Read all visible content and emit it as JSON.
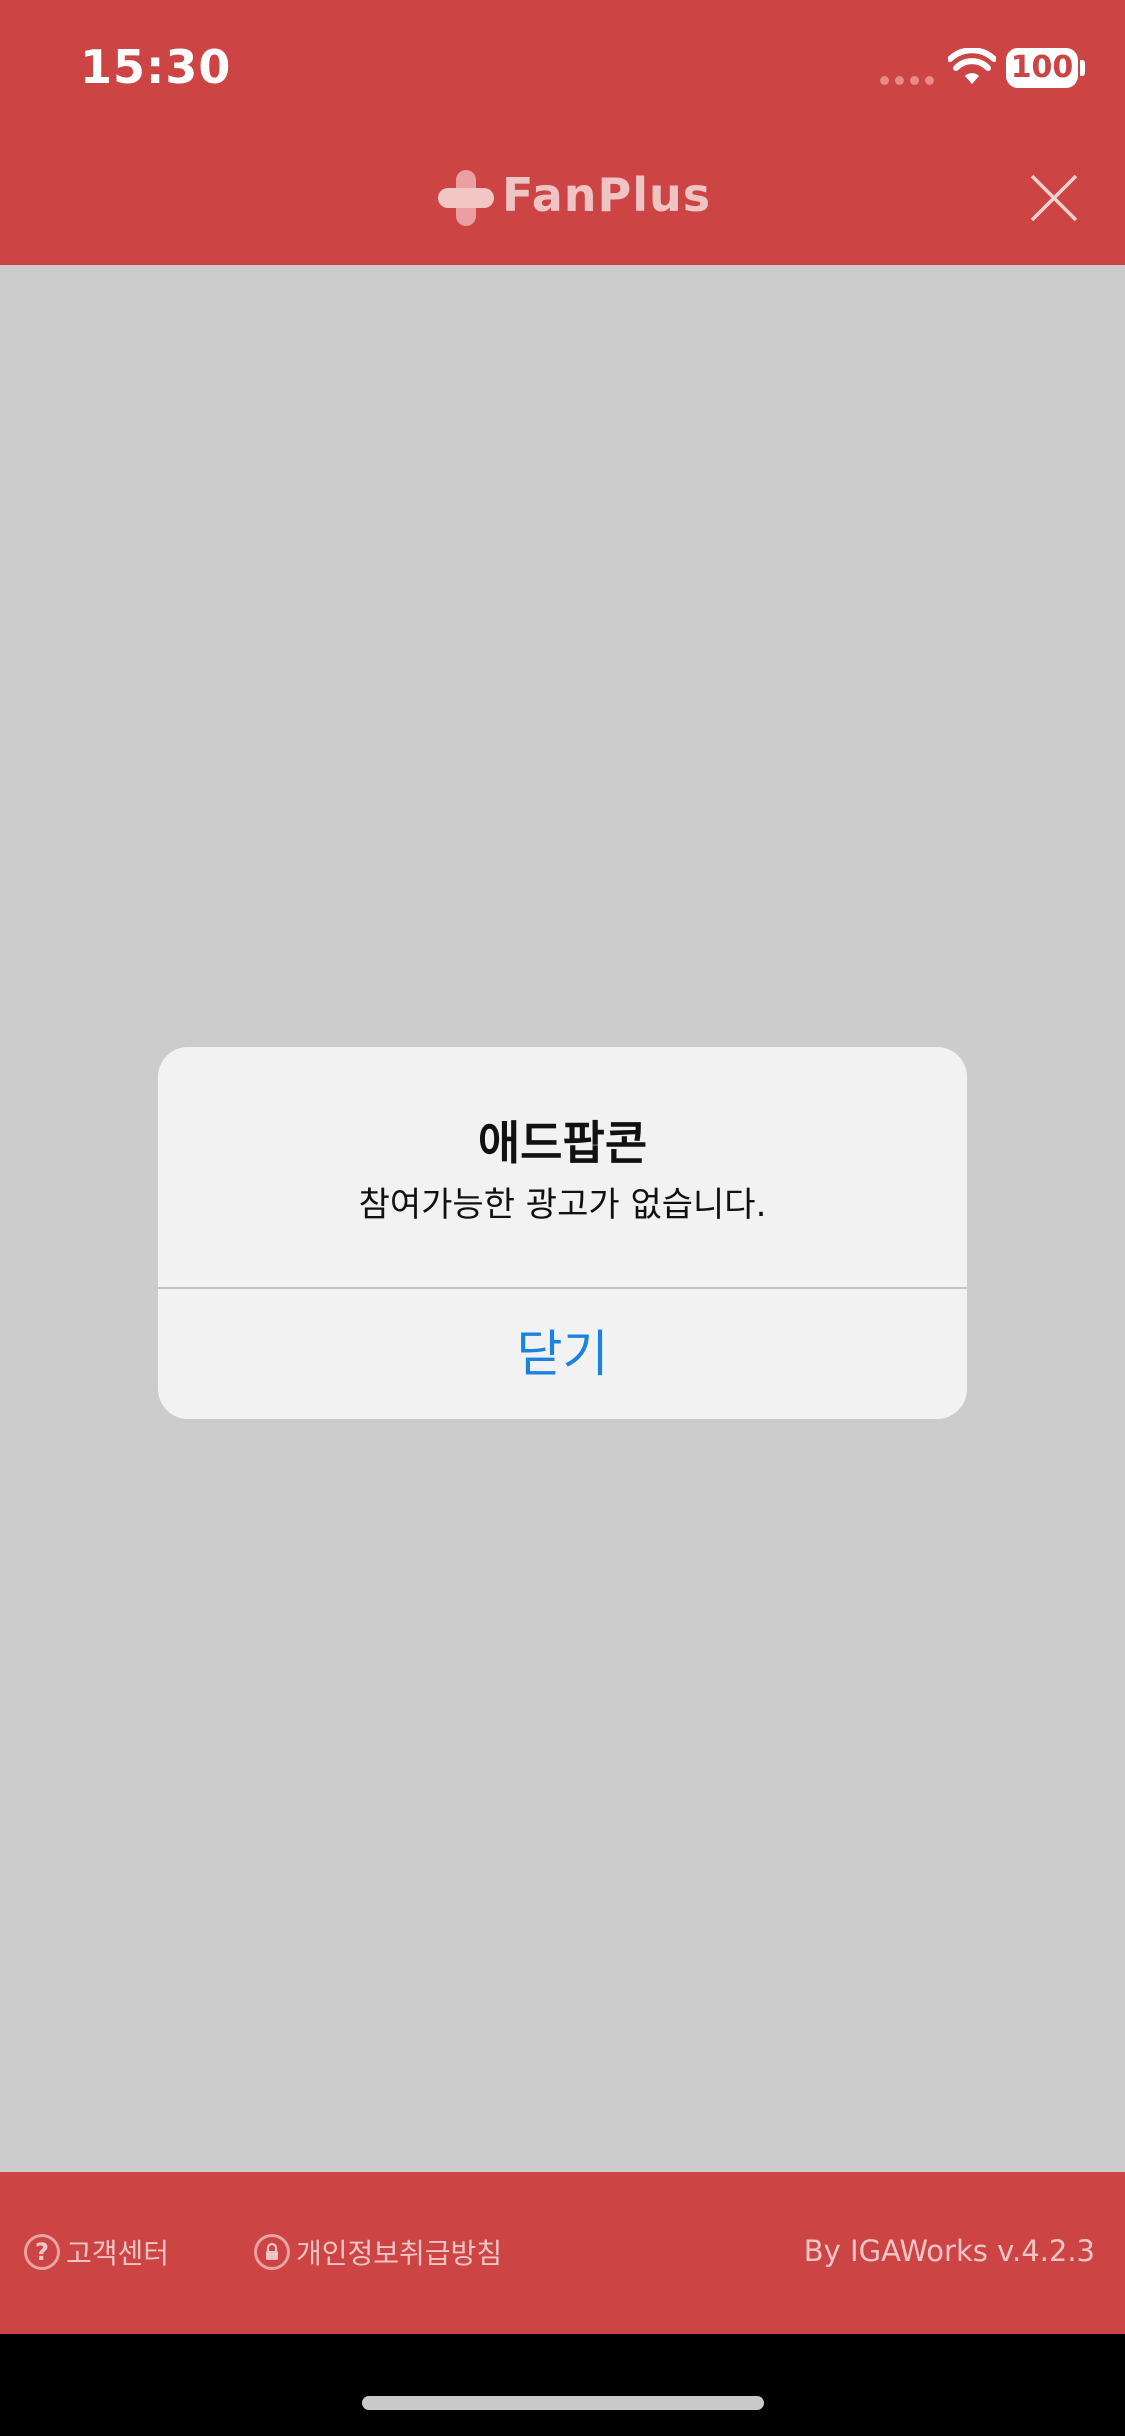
{
  "status_bar": {
    "time": "15:30",
    "battery": "100"
  },
  "header": {
    "app_name": "FanPlus",
    "logo_icon": "fanplus-cross-logo-icon",
    "close_icon": "close-icon"
  },
  "alert": {
    "title": "애드팝콘",
    "message": "참여가능한 광고가 없습니다.",
    "button_label": "닫기"
  },
  "footer": {
    "customer_center": "고객센터",
    "privacy_policy": "개인정보취급방침",
    "version": "By IGAWorks v.4.2.3"
  },
  "colors": {
    "brand_red": "#cc4444",
    "alert_button_blue": "#1a82e0",
    "overlay_gray": "#cccccc"
  }
}
